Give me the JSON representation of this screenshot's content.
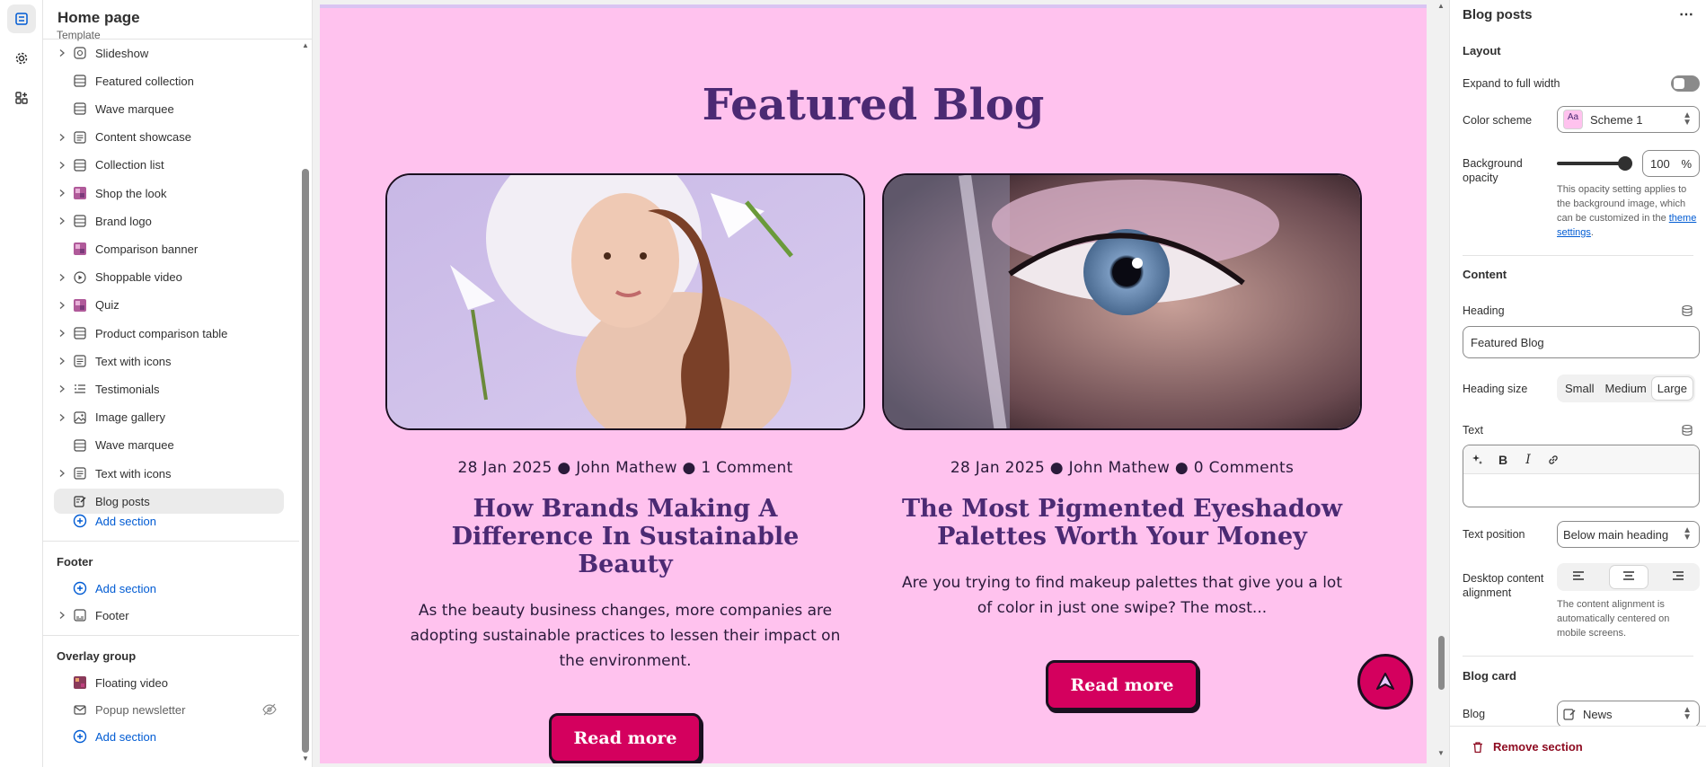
{
  "sidebar": {
    "title": "Home page",
    "partial_group": "Template",
    "items": [
      {
        "label": "Slideshow",
        "icon": "slideshow-icon",
        "chevron": true
      },
      {
        "label": "Featured collection",
        "icon": "section-icon",
        "chevron": false
      },
      {
        "label": "Wave marquee",
        "icon": "section-icon",
        "chevron": false
      },
      {
        "label": "Content showcase",
        "icon": "text-block-icon",
        "chevron": true
      },
      {
        "label": "Collection list",
        "icon": "section-icon",
        "chevron": true
      },
      {
        "label": "Shop the look",
        "icon": "image-thumb-icon",
        "chevron": true
      },
      {
        "label": "Brand logo",
        "icon": "section-icon",
        "chevron": true
      },
      {
        "label": "Comparison banner",
        "icon": "image-thumb-icon",
        "chevron": false
      },
      {
        "label": "Shoppable video",
        "icon": "play-icon",
        "chevron": true
      },
      {
        "label": "Quiz",
        "icon": "image-thumb-icon",
        "chevron": true
      },
      {
        "label": "Product comparison table",
        "icon": "section-icon",
        "chevron": true
      },
      {
        "label": "Text with icons",
        "icon": "text-block-icon",
        "chevron": true
      },
      {
        "label": "Testimonials",
        "icon": "list-icon",
        "chevron": true
      },
      {
        "label": "Image gallery",
        "icon": "image-icon",
        "chevron": true
      },
      {
        "label": "Wave marquee",
        "icon": "section-icon",
        "chevron": false
      },
      {
        "label": "Text with icons",
        "icon": "text-block-icon",
        "chevron": true
      },
      {
        "label": "Blog posts",
        "icon": "blog-icon",
        "chevron": false,
        "selected": true
      }
    ],
    "add_section": "Add section",
    "footer_group": {
      "title": "Footer",
      "add_section": "Add section",
      "items": [
        {
          "label": "Footer",
          "icon": "footer-icon"
        }
      ]
    },
    "overlay_group": {
      "title": "Overlay group",
      "items": [
        {
          "label": "Floating video",
          "icon": "image-thumb-icon"
        },
        {
          "label": "Popup newsletter",
          "icon": "mail-icon",
          "hidden": true
        }
      ],
      "add_section": "Add section"
    }
  },
  "preview": {
    "heading": "Featured Blog",
    "posts": [
      {
        "date": "28 Jan 2025",
        "author": "John Mathew",
        "comments": "1 Comment",
        "title": "How Brands Making A Difference In Sustainable Beauty",
        "excerpt": "As the beauty business changes, more companies are adopting sustainable practices to lessen their impact on the environment.",
        "button": "Read more"
      },
      {
        "date": "28 Jan 2025",
        "author": "John Mathew",
        "comments": "0 Comments",
        "title": "The Most Pigmented Eyeshadow Palettes Worth Your Money",
        "excerpt": "Are you trying to find makeup palettes that give you a lot of color in just one swipe? The most...",
        "button": "Read more"
      }
    ],
    "colors": {
      "background": "#ffc2ee",
      "heading": "#4b2a73",
      "button": "#d4005e"
    }
  },
  "panel": {
    "title": "Blog posts",
    "layout_heading": "Layout",
    "expand_label": "Expand to full width",
    "expand_on": false,
    "color_scheme_label": "Color scheme",
    "color_scheme_value": "Scheme 1",
    "color_scheme_swatch": "Aa",
    "bg_opacity_label": "Background opacity",
    "bg_opacity_value": "100",
    "bg_opacity_unit": "%",
    "bg_opacity_help_pre": "This opacity setting applies to the background image, which can be customized in the",
    "bg_opacity_help_link": "theme settings",
    "bg_opacity_help_post": ".",
    "content_heading": "Content",
    "heading_label": "Heading",
    "heading_value": "Featured Blog",
    "heading_size_label": "Heading size",
    "heading_sizes": [
      "Small",
      "Medium",
      "Large"
    ],
    "heading_size_selected": "Large",
    "text_label": "Text",
    "text_position_label": "Text position",
    "text_position_value": "Below main heading",
    "alignment_label": "Desktop content alignment",
    "alignment_selected": "center",
    "alignment_help": "The content alignment is automatically centered on mobile screens.",
    "blog_card_heading": "Blog card",
    "blog_label": "Blog",
    "blog_value": "News",
    "remove_label": "Remove section"
  }
}
